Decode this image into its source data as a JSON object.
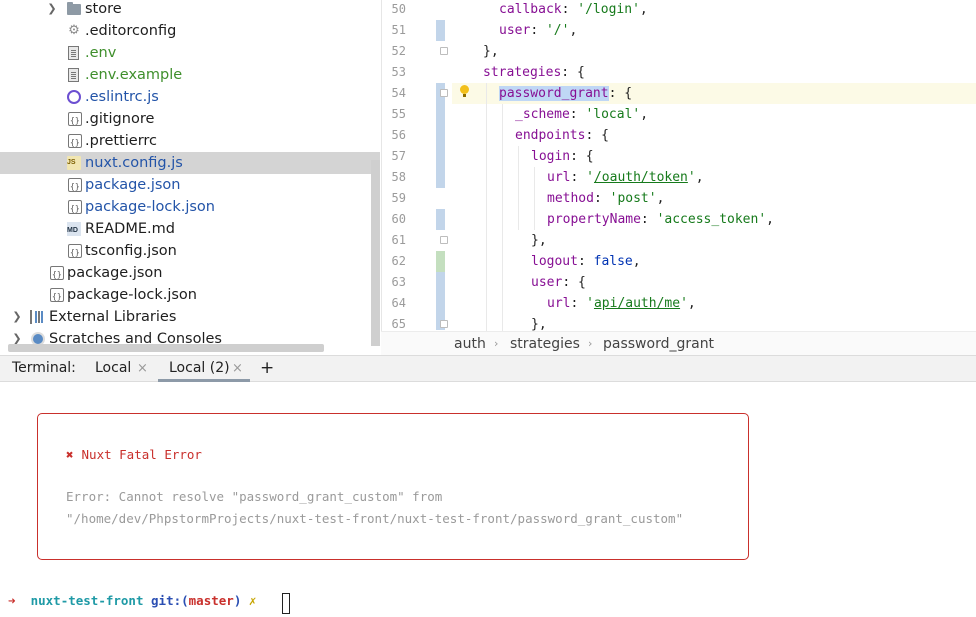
{
  "project_tree": {
    "items": [
      {
        "label": "store",
        "type": "folder"
      },
      {
        "label": ".editorconfig",
        "type": "gear"
      },
      {
        "label": ".env",
        "type": "doc",
        "color": "#3f8f2c"
      },
      {
        "label": ".env.example",
        "type": "doc",
        "color": "#3f8f2c"
      },
      {
        "label": ".eslintrc.js",
        "type": "eslint",
        "color": "#2354a8"
      },
      {
        "label": ".gitignore",
        "type": "config"
      },
      {
        "label": ".prettierrc",
        "type": "config"
      },
      {
        "label": "nuxt.config.js",
        "type": "js",
        "color": "#2354a8",
        "selected": true
      },
      {
        "label": "package.json",
        "type": "config",
        "color": "#2354a8"
      },
      {
        "label": "package-lock.json",
        "type": "config",
        "color": "#2354a8"
      },
      {
        "label": "README.md",
        "type": "md"
      },
      {
        "label": "tsconfig.json",
        "type": "config"
      },
      {
        "label": "package.json",
        "type": "config"
      },
      {
        "label": "package-lock.json",
        "type": "config"
      },
      {
        "label": "External Libraries",
        "type": "libraries"
      },
      {
        "label": "Scratches and Consoles",
        "type": "scratches"
      }
    ]
  },
  "editor": {
    "line_numbers": [
      "50",
      "51",
      "52",
      "53",
      "54",
      "55",
      "56",
      "57",
      "58",
      "59",
      "60",
      "61",
      "62",
      "63",
      "64",
      "65"
    ],
    "lines": {
      "l50": {
        "key": "callback",
        "value": "'/login'"
      },
      "l51": {
        "key": "user",
        "value": "'/'"
      },
      "l52": {
        "text": "},"
      },
      "l53": {
        "key": "strategies",
        "text": "{"
      },
      "l54": {
        "key": "password_grant",
        "text": "{"
      },
      "l55": {
        "key": "_scheme",
        "value": "'local'"
      },
      "l56": {
        "key": "endpoints",
        "text": "{"
      },
      "l57": {
        "key": "login",
        "text": "{"
      },
      "l58": {
        "key": "url",
        "value_q1": "'",
        "value_link": "/oauth/token",
        "value_q2": "'"
      },
      "l59": {
        "key": "method",
        "value": "'post'"
      },
      "l60": {
        "key": "propertyName",
        "value": "'access_token'"
      },
      "l61": {
        "text": "},"
      },
      "l62": {
        "key": "logout",
        "value": "false"
      },
      "l63": {
        "key": "user",
        "text": "{"
      },
      "l64": {
        "key": "url",
        "value_q1": "'",
        "value_link": "api/auth/me",
        "value_q2": "'"
      },
      "l65": {
        "text": "},"
      }
    }
  },
  "breadcrumb": [
    "auth",
    "strategies",
    "password_grant"
  ],
  "terminal": {
    "label": "Terminal:",
    "tabs": [
      {
        "label": "Local",
        "active": false
      },
      {
        "label": "Local (2)",
        "active": true
      }
    ],
    "add_label": "+",
    "close_glyph": "×",
    "error": {
      "title": "Nuxt Fatal Error",
      "line1": "Error: Cannot resolve \"password_grant_custom\" from",
      "line2": "\"/home/dev/PhpstormProjects/nuxt-test-front/nuxt-test-front/password_grant_custom\""
    },
    "prompt": {
      "arrow": "➜",
      "dir": "nuxt-test-front",
      "git": "git:(",
      "branch": "master",
      "git_close": ")",
      "dirty": "✗"
    }
  }
}
